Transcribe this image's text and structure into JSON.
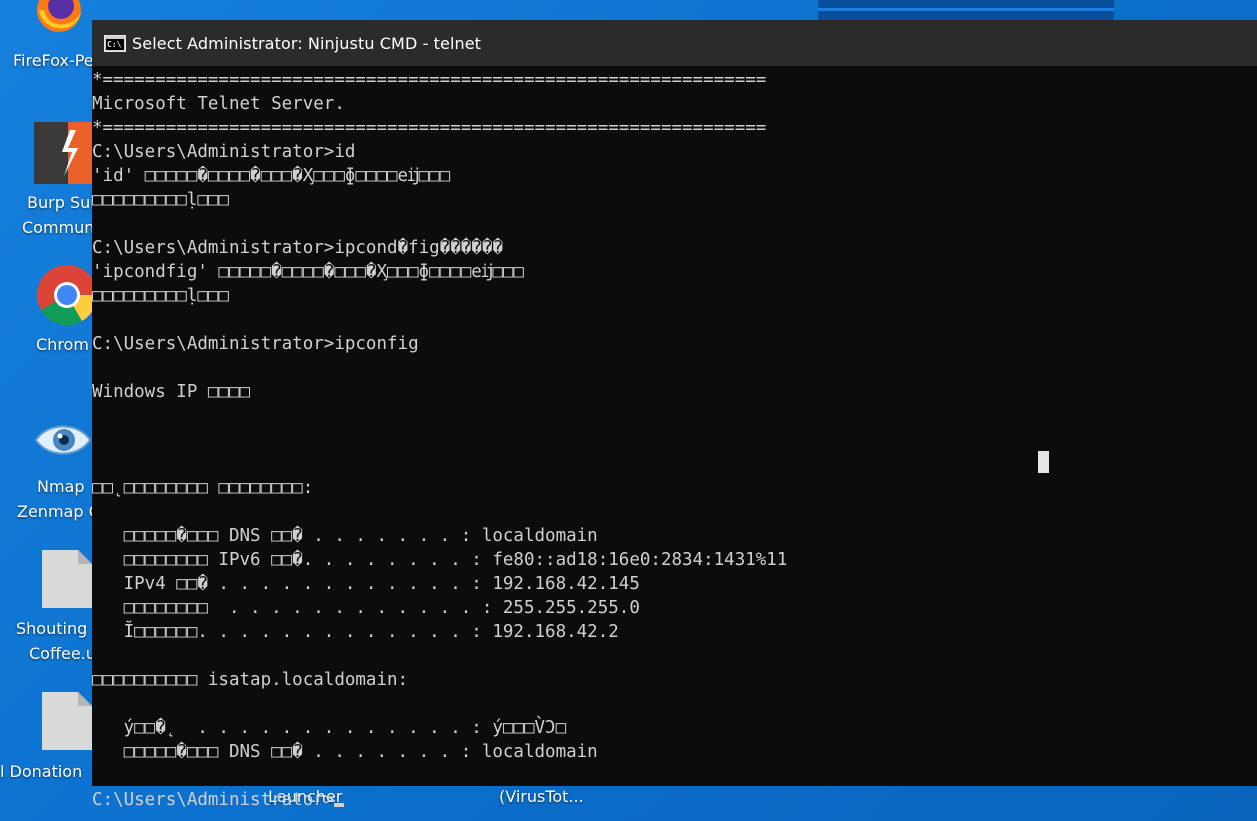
{
  "window": {
    "title": "Select Administrator:  Ninjustu CMD - telnet",
    "icon": "cmd-icon"
  },
  "console": {
    "lines": [
      "*===============================================================",
      "Microsoft Telnet Server.",
      "*===============================================================",
      "C:\\Users\\Administrator>id",
      "'id' □□□□□�□□□□�□□□�X̧□□□ɸ□□□□eĳ□□□",
      "□□□□□□□□□ḷ□□□",
      "",
      "C:\\Users\\Administrator>ipcond�fig������",
      "'ipcondfig' □□□□□�□□□□�□□□�X̧□□□ɸ□□□□eĳ□□□",
      "□□□□□□□□□ḷ□□□",
      "",
      "C:\\Users\\Administrator>ipconfig",
      "",
      "Windows IP □□□□",
      "",
      "",
      "",
      "□□˛□□□□□□□□ □□□□□□□□:",
      "",
      "   □□□□□�□□□ DNS □□� . . . . . . . : localdomain",
      "   □□□□□□□□ IPv6 □□�. . . . . . . . : fe80::ad18:16e0:2834:1431%11",
      "   IPv4 □□� . . . . . . . . . . . . : 192.168.42.145",
      "   □□□□□□□□  . . . . . . . . . . . . : 255.255.255.0",
      "   Ĭ□□□□□□. . . . . . . . . . . . . : 192.168.42.2",
      "",
      "□□□□□□□□□□ isatap.localdomain:",
      "",
      "   ý□□�˛  . . . . . . . . . . . . . : ý□□□V̀Ͻ□",
      "   □□□□□�□□□ DNS □□� . . . . . . . : localdomain",
      "",
      "C:\\Users\\Administrator>"
    ]
  },
  "desktop": {
    "icons": [
      {
        "label1": "FireFox-Pe",
        "label2": "",
        "icon": "firefox-icon"
      },
      {
        "label1": "Burp Sui",
        "label2": "Commun",
        "icon": "burp-suite-icon"
      },
      {
        "label1": "Chrom",
        "label2": "",
        "icon": "chrome-icon"
      },
      {
        "label1": "Nmap",
        "label2": "Zenmap G",
        "icon": "nmap-eye-icon"
      },
      {
        "label1": "Shouting",
        "label2": "Coffee.u",
        "icon": "file-icon"
      },
      {
        "label1": "l  Donation",
        "label2": "",
        "icon": "file-icon"
      }
    ],
    "bottom_labels": [
      "Launcher",
      "(VirusTot..."
    ]
  }
}
